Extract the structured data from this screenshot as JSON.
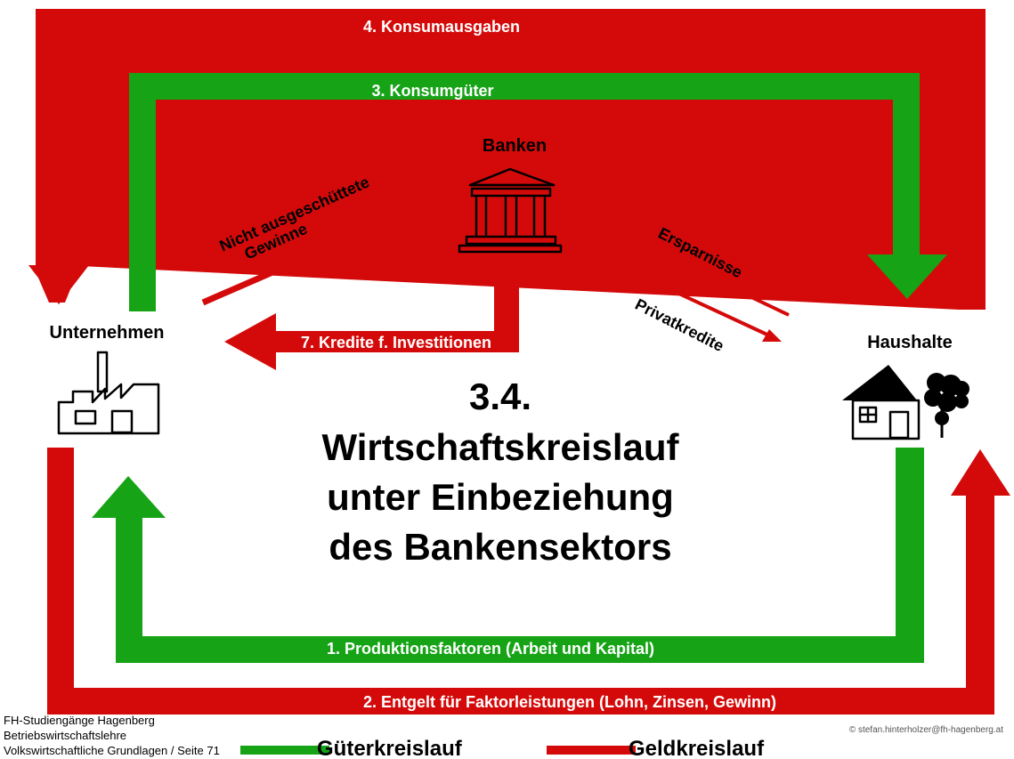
{
  "colors": {
    "goods": "#16a316",
    "money": "#d40a0a"
  },
  "flows": {
    "f4": "4. Konsumausgaben",
    "f3": "3. Konsumgüter",
    "f1": "1. Produktionsfaktoren (Arbeit und Kapital)",
    "f2": "2. Entgelt für Faktorleistungen (Lohn, Zinsen, Gewinn)",
    "f7": "7.  Kredite f. Investitionen"
  },
  "nodes": {
    "banks": "Banken",
    "firms": "Unternehmen",
    "households": "Haushalte"
  },
  "diagonal": {
    "retained_line1": "Nicht ausgeschüttete",
    "retained_line2": "Gewinne",
    "savings": "Ersparnisse",
    "private_credit": "Privatkredite"
  },
  "title": {
    "line1": "3.4.",
    "line2": "Wirtschaftskreislauf",
    "line3": "unter Einbeziehung",
    "line4": "des Bankensektors"
  },
  "footer": {
    "line1": "FH-Studiengänge Hagenberg",
    "line2": "Betriebswirtschaftslehre",
    "line3": "Volkswirtschaftliche Grundlagen / Seite 71",
    "copyright": "© stefan.hinterholzer@fh-hagenberg.at"
  },
  "legend": {
    "goods_label": "Güterkreislauf",
    "money_label": "Geldkreislauf"
  }
}
